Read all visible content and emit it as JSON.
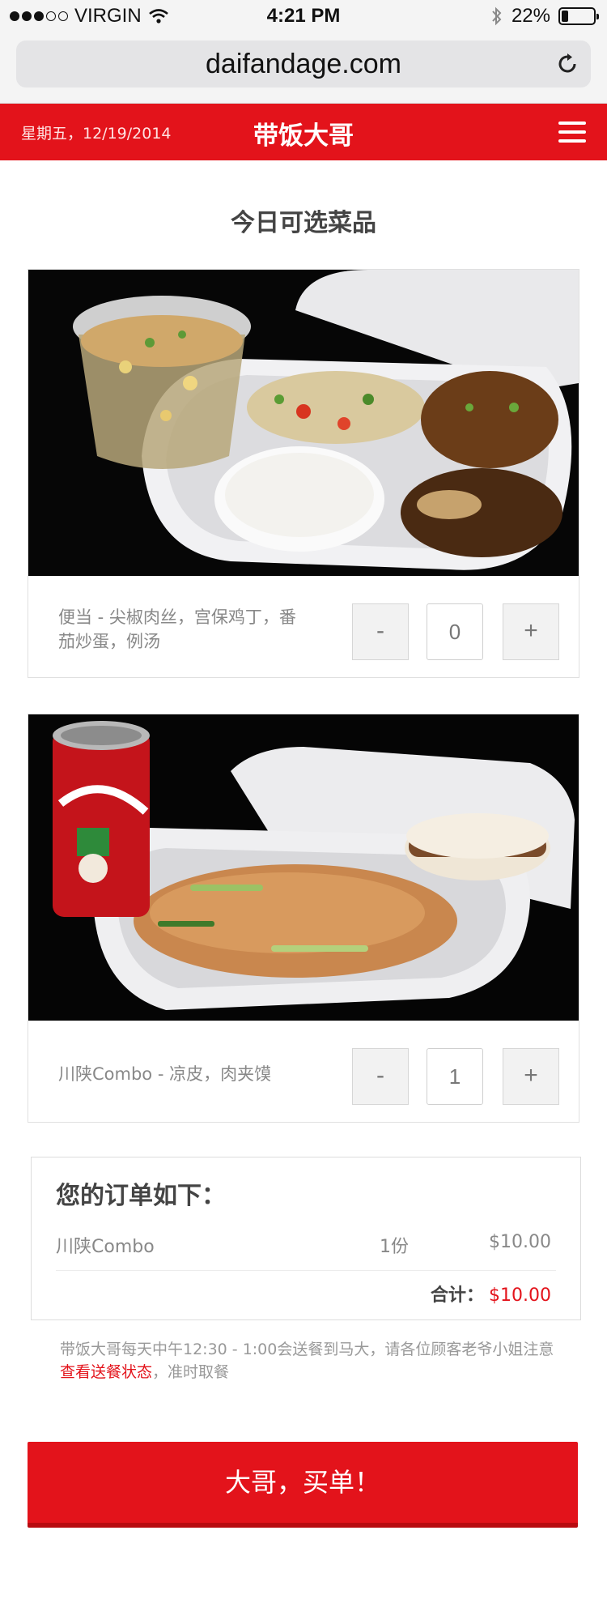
{
  "status_bar": {
    "carrier": "VIRGIN",
    "time": "4:21 PM",
    "battery_percent_label": "22%",
    "battery_level": 0.22
  },
  "browser": {
    "url": "daifandage.com"
  },
  "header": {
    "date": "星期五，12/19/2014",
    "title": "带饭大哥"
  },
  "menu": {
    "section_title": "今日可选菜品",
    "items": [
      {
        "name": "便当 - 尖椒肉丝，宫保鸡丁，番茄炒蛋，例汤",
        "qty": "0",
        "minus": "-",
        "plus": "+"
      },
      {
        "name": "川陕Combo - 凉皮，肉夹馍",
        "qty": "1",
        "minus": "-",
        "plus": "+"
      }
    ]
  },
  "order": {
    "title": "您的订单如下：",
    "lines": [
      {
        "name": "川陕Combo",
        "qty": "1份",
        "price": "$10.00"
      }
    ],
    "total_label": "合计：",
    "total_value": "$10.00"
  },
  "notice": {
    "text_before": "带饭大哥每天中午12:30 - 1:00会送餐到马大，请各位顾客老爷小姐注意",
    "link_text": "查看送餐状态",
    "text_after": "，准时取餐"
  },
  "checkout": {
    "label": "大哥，买单！"
  },
  "colors": {
    "brand_red": "#e3131b",
    "background": "#ffffff"
  }
}
